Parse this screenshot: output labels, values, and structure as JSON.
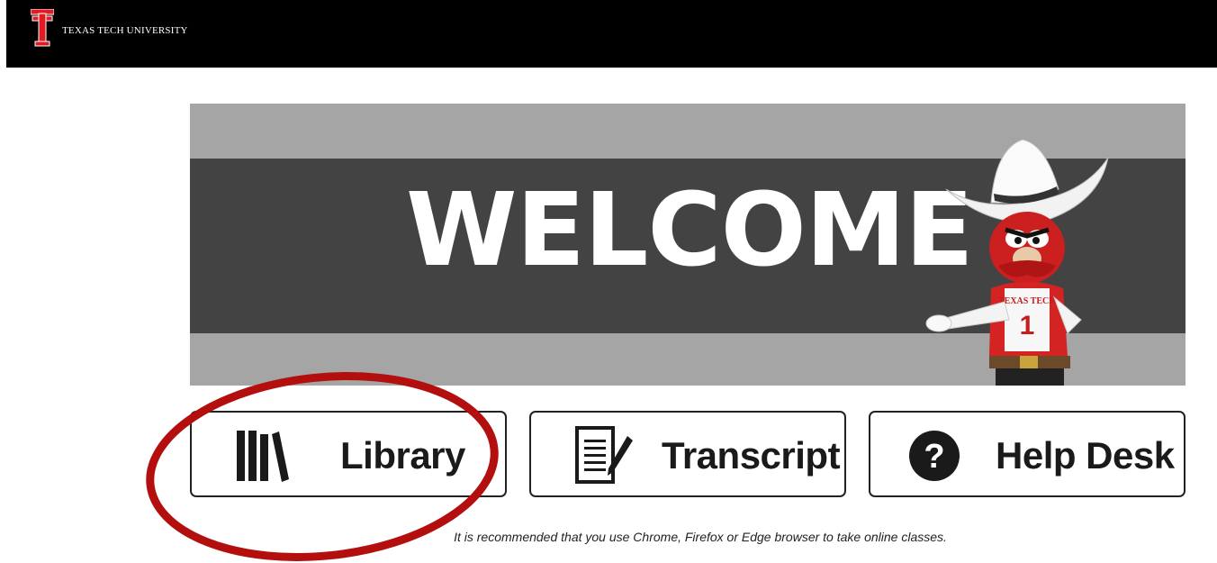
{
  "header": {
    "brand": "TEXAS TECH UNIVERSITY",
    "logo_icon": "double-t-logo-icon",
    "background": "#000000"
  },
  "banner": {
    "headline": "WELCOME",
    "mascot_jersey_text": "TEXAS TECH",
    "mascot_jersey_number": "1",
    "mascot": "raider-red-mascot-illustration"
  },
  "buttons": [
    {
      "label": "Library",
      "icon": "books-icon"
    },
    {
      "label": "Transcript",
      "icon": "document-pen-icon"
    },
    {
      "label": "Help Desk",
      "icon": "question-circle-icon"
    }
  ],
  "notice": "It is recommended that you use Chrome, Firefox or Edge browser to take online classes.",
  "colors": {
    "annotation_red": "#b30f0f",
    "banner_light": "#a5a5a5",
    "banner_dark": "#434343",
    "mascot_red": "#cc1f1f"
  }
}
